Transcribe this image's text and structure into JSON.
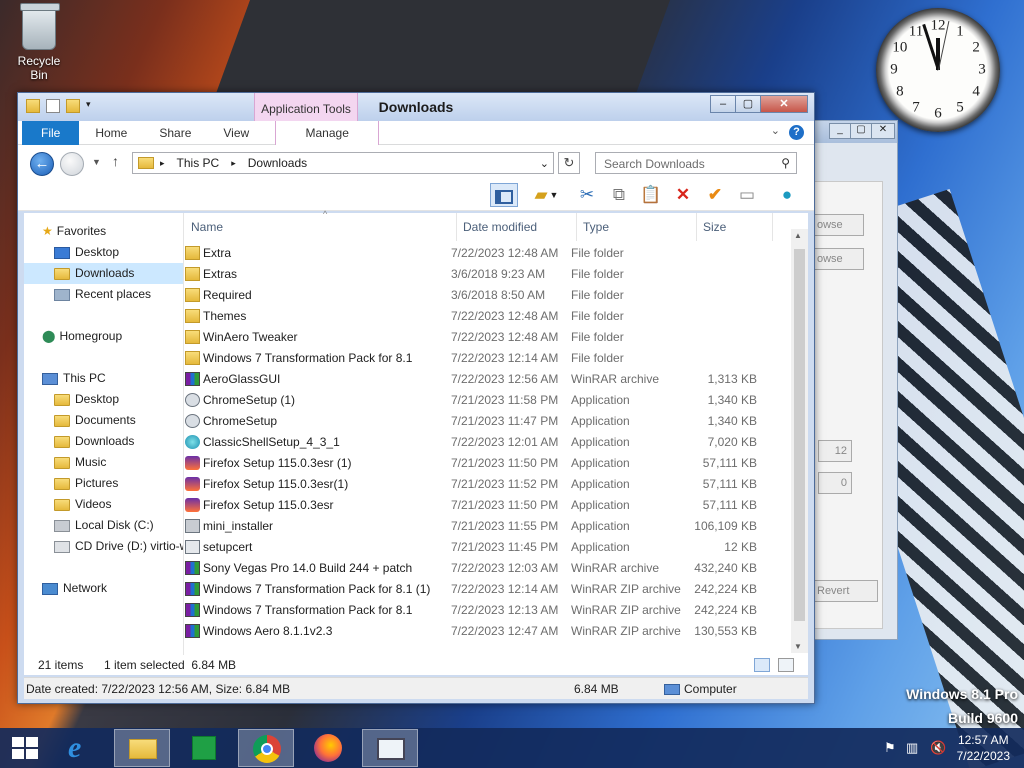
{
  "desktop": {
    "recycle_bin": "Recycle Bin",
    "watermark_line1": "Windows 8.1 Pro",
    "watermark_line2": "Build 9600",
    "clock_numbers": [
      "12",
      "1",
      "2",
      "3",
      "4",
      "5",
      "6",
      "7",
      "8",
      "9",
      "10",
      "11"
    ],
    "bg_window": {
      "browse1": "owse",
      "browse2": "owse",
      "val1": "12",
      "val2": "0",
      "revert": "Revert"
    }
  },
  "window": {
    "title": "Downloads",
    "context_tab": "Application Tools",
    "ribbon_tabs": {
      "file": "File",
      "home": "Home",
      "share": "Share",
      "view": "View",
      "manage": "Manage"
    },
    "breadcrumb": [
      "This PC",
      "Downloads"
    ],
    "search_placeholder": "Search Downloads",
    "columns": {
      "name": "Name",
      "date": "Date modified",
      "type": "Type",
      "size": "Size"
    }
  },
  "nav": {
    "favorites": "Favorites",
    "fav_items": [
      "Desktop",
      "Downloads",
      "Recent places"
    ],
    "homegroup": "Homegroup",
    "this_pc": "This PC",
    "pc_items": [
      "Desktop",
      "Documents",
      "Downloads",
      "Music",
      "Pictures",
      "Videos",
      "Local Disk (C:)",
      "CD Drive (D:) virtio-w"
    ],
    "network": "Network"
  },
  "files": [
    {
      "name": "Extra",
      "date": "7/22/2023 12:48 AM",
      "type": "File folder",
      "size": "",
      "icon": "folder-icon"
    },
    {
      "name": "Extras",
      "date": "3/6/2018 9:23 AM",
      "type": "File folder",
      "size": "",
      "icon": "folder-icon"
    },
    {
      "name": "Required",
      "date": "3/6/2018 8:50 AM",
      "type": "File folder",
      "size": "",
      "icon": "folder-icon"
    },
    {
      "name": "Themes",
      "date": "7/22/2023 12:48 AM",
      "type": "File folder",
      "size": "",
      "icon": "folder-icon"
    },
    {
      "name": "WinAero Tweaker",
      "date": "7/22/2023 12:48 AM",
      "type": "File folder",
      "size": "",
      "icon": "folder-icon"
    },
    {
      "name": "Windows 7 Transformation Pack for 8.1",
      "date": "7/22/2023 12:14 AM",
      "type": "File folder",
      "size": "",
      "icon": "folder-icon"
    },
    {
      "name": "AeroGlassGUI",
      "date": "7/22/2023 12:56 AM",
      "type": "WinRAR archive",
      "size": "1,313 KB",
      "icon": "winrar-icon"
    },
    {
      "name": "ChromeSetup (1)",
      "date": "7/21/2023 11:58 PM",
      "type": "Application",
      "size": "1,340 KB",
      "icon": "setup-icon"
    },
    {
      "name": "ChromeSetup",
      "date": "7/21/2023 11:47 PM",
      "type": "Application",
      "size": "1,340 KB",
      "icon": "setup-icon"
    },
    {
      "name": "ClassicShellSetup_4_3_1",
      "date": "7/22/2023 12:01 AM",
      "type": "Application",
      "size": "7,020 KB",
      "icon": "shell-icon"
    },
    {
      "name": "Firefox Setup 115.0.3esr (1)",
      "date": "7/21/2023 11:50 PM",
      "type": "Application",
      "size": "57,111 KB",
      "icon": "firefox-icon"
    },
    {
      "name": "Firefox Setup 115.0.3esr(1)",
      "date": "7/21/2023 11:52 PM",
      "type": "Application",
      "size": "57,111 KB",
      "icon": "firefox-icon"
    },
    {
      "name": "Firefox Setup 115.0.3esr",
      "date": "7/21/2023 11:50 PM",
      "type": "Application",
      "size": "57,111 KB",
      "icon": "firefox-icon"
    },
    {
      "name": "mini_installer",
      "date": "7/21/2023 11:55 PM",
      "type": "Application",
      "size": "106,109 KB",
      "icon": "installer-icon"
    },
    {
      "name": "setupcert",
      "date": "7/21/2023 11:45 PM",
      "type": "Application",
      "size": "12 KB",
      "icon": "app-icon"
    },
    {
      "name": "Sony Vegas Pro 14.0 Build 244 + patch",
      "date": "7/22/2023 12:03 AM",
      "type": "WinRAR archive",
      "size": "432,240 KB",
      "icon": "winrar-icon"
    },
    {
      "name": "Windows 7 Transformation Pack for 8.1 (1)",
      "date": "7/22/2023 12:14 AM",
      "type": "WinRAR ZIP archive",
      "size": "242,224 KB",
      "icon": "winrar-icon"
    },
    {
      "name": "Windows 7 Transformation Pack for 8.1",
      "date": "7/22/2023 12:13 AM",
      "type": "WinRAR ZIP archive",
      "size": "242,224 KB",
      "icon": "winrar-icon"
    },
    {
      "name": "Windows Aero 8.1.1v2.3",
      "date": "7/22/2023 12:47 AM",
      "type": "WinRAR ZIP archive",
      "size": "130,553 KB",
      "icon": "winrar-icon"
    }
  ],
  "status": {
    "count": "21 items",
    "selected": "1 item selected  6.84 MB",
    "details": "Date created: 7/22/2023 12:56 AM, Size: 6.84 MB",
    "details_size": "6.84 MB",
    "location": "Computer"
  },
  "taskbar": {
    "time": "12:57 AM",
    "date": "7/22/2023"
  },
  "colors": {
    "accent": "#1979ca",
    "selection": "#cce8ff",
    "taskbar": "#122a5c"
  }
}
